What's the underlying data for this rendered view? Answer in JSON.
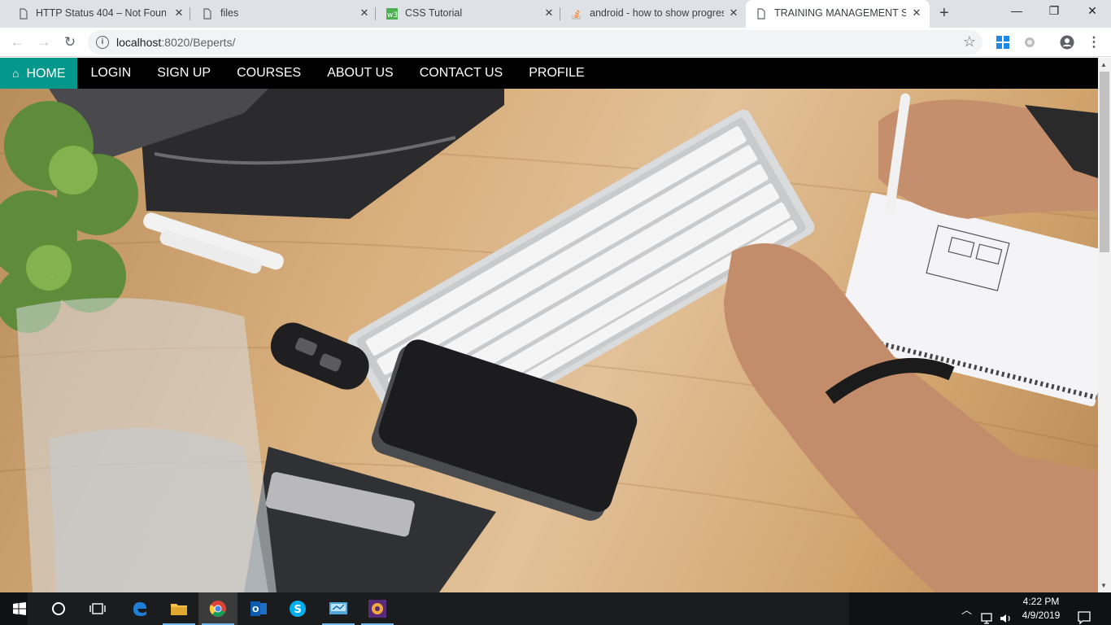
{
  "browser": {
    "tabs": [
      {
        "title": "HTTP Status 404 – Not Found",
        "icon": "page-icon",
        "active": false
      },
      {
        "title": "files",
        "icon": "page-icon",
        "active": false
      },
      {
        "title": "CSS Tutorial",
        "icon": "w3schools-icon",
        "active": false
      },
      {
        "title": "android - how to show progres",
        "icon": "stackoverflow-icon",
        "active": false
      },
      {
        "title": "TRAINING MANAGEMENT SYS",
        "icon": "page-icon",
        "active": true
      }
    ],
    "address": {
      "host": "localhost",
      "path": ":8020/Beperts/"
    }
  },
  "nav": {
    "items": [
      {
        "label": "HOME",
        "icon": "home-icon",
        "active": true
      },
      {
        "label": "LOGIN"
      },
      {
        "label": "SIGN UP"
      },
      {
        "label": "COURSES"
      },
      {
        "label": "ABOUT US"
      },
      {
        "label": "CONTACT US"
      },
      {
        "label": "PROFILE"
      }
    ],
    "active_color": "#04978c",
    "bar_color": "#000000"
  },
  "hero": {
    "description_icon": "desk-photo"
  },
  "taskbar": {
    "apps": [
      "windows-start-icon",
      "cortana-icon",
      "task-view-icon",
      "edge-icon",
      "file-explorer-icon",
      "chrome-icon",
      "outlook-icon",
      "skype-icon",
      "control-panel-icon",
      "app-icon"
    ],
    "clock": {
      "time": "4:22 PM",
      "date": "4/9/2019"
    }
  }
}
